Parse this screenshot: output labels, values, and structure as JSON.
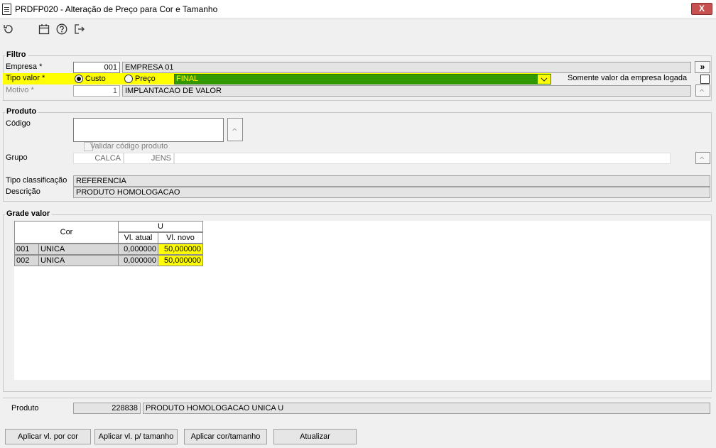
{
  "window": {
    "title": "PRDFP020 - Alteração de Preço para Cor e Tamanho",
    "close_label": "X"
  },
  "toolbar": {
    "icons": [
      "refresh-icon",
      "calendar-icon",
      "help-icon",
      "exit-icon"
    ]
  },
  "filtro": {
    "legend": "Filtro",
    "empresa": {
      "label": "Empresa *",
      "code": "001",
      "name": "EMPRESA 01",
      "button": "»"
    },
    "tipo_valor": {
      "label": "Tipo valor *",
      "option_custo": "Custo",
      "option_preco": "Preço",
      "selected": "Custo",
      "preco_select_value": "FINAL",
      "somente_label": "Somente valor da empresa logada",
      "highlight_color": "#ffff00",
      "select_color": "#339900"
    },
    "motivo": {
      "label": "Motivo *",
      "code": "1",
      "name": "IMPLANTACAO DE VALOR"
    }
  },
  "produto": {
    "legend": "Produto",
    "codigo": {
      "label": "Código",
      "value": ""
    },
    "validar_label": "Validar código produto",
    "grupo": {
      "label": "Grupo",
      "value1": "CALCA",
      "value2": "JENS",
      "value3": ""
    },
    "tipo_classificacao": {
      "label": "Tipo classificação",
      "value": "REFERENCIA"
    },
    "descricao": {
      "label": "Descrição",
      "value": "PRODUTO HOMOLOGACAO"
    }
  },
  "grade": {
    "legend": "Grade valor",
    "header_cor": "Cor",
    "header_size": "U",
    "header_atual": "Vl. atual",
    "header_novo": "Vl. novo",
    "rows": [
      {
        "code": "001",
        "name": "UNICA",
        "atual": "0,000000",
        "novo": "50,000000"
      },
      {
        "code": "002",
        "name": "UNICA",
        "atual": "0,000000",
        "novo": "50,000000"
      }
    ]
  },
  "footer_produto": {
    "label": "Produto",
    "code": "228838",
    "name": "PRODUTO HOMOLOGACAO UNICA U"
  },
  "buttons": {
    "aplicar_cor": "Aplicar vl. por cor",
    "aplicar_tamanho": "Aplicar vl. p/ tamanho",
    "aplicar_cor_tamanho": "Aplicar cor/tamanho",
    "atualizar": "Atualizar"
  }
}
